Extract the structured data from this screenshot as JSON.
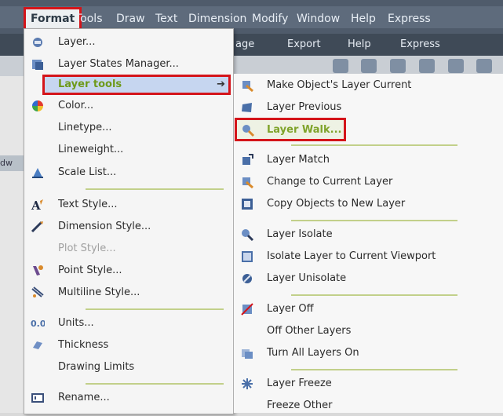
{
  "menubar": {
    "items": [
      "Format",
      "Tools",
      "Draw",
      "Text",
      "Dimension",
      "Modify",
      "Window",
      "Help",
      "Express"
    ]
  },
  "ribbon": {
    "items": [
      "age",
      "Export",
      "Help",
      "Express"
    ]
  },
  "left_tab_label": "dw",
  "format_menu": {
    "items": [
      {
        "label": "Layer...",
        "icon": "layer-icon"
      },
      {
        "label": "Layer States Manager...",
        "icon": "layer-states-icon"
      },
      {
        "label": "Layer tools",
        "icon": "",
        "submenu": true
      },
      {
        "label": "Color...",
        "icon": "color-wheel-icon"
      },
      {
        "label": "Linetype...",
        "icon": ""
      },
      {
        "label": "Lineweight...",
        "icon": ""
      },
      {
        "label": "Scale List...",
        "icon": "scale-list-icon"
      },
      {
        "label": "Text Style...",
        "icon": "text-style-icon"
      },
      {
        "label": "Dimension Style...",
        "icon": "dimension-style-icon"
      },
      {
        "label": "Plot Style...",
        "icon": "",
        "disabled": true
      },
      {
        "label": "Point Style...",
        "icon": "point-style-icon"
      },
      {
        "label": "Multiline Style...",
        "icon": "multiline-style-icon"
      },
      {
        "label": "Units...",
        "icon": "units-icon"
      },
      {
        "label": "Thickness",
        "icon": "thickness-icon"
      },
      {
        "label": "Drawing Limits",
        "icon": ""
      },
      {
        "label": "Rename...",
        "icon": "rename-icon"
      }
    ],
    "submenu_arrow": "➔"
  },
  "layer_tools_menu": {
    "items": [
      {
        "label": "Make Object's Layer Current",
        "icon": "make-current-icon"
      },
      {
        "label": "Layer Previous",
        "icon": "layer-previous-icon"
      },
      {
        "label": "Layer Walk...",
        "icon": "layer-walk-icon",
        "highlighted": true
      },
      {
        "label": "Layer Match",
        "icon": "layer-match-icon"
      },
      {
        "label": "Change to Current Layer",
        "icon": "change-current-icon"
      },
      {
        "label": "Copy Objects to New Layer",
        "icon": "copy-objects-icon"
      },
      {
        "label": "Layer Isolate",
        "icon": "layer-isolate-icon"
      },
      {
        "label": "Isolate Layer to Current Viewport",
        "icon": "isolate-viewport-icon"
      },
      {
        "label": "Layer Unisolate",
        "icon": "layer-unisolate-icon"
      },
      {
        "label": "Layer Off",
        "icon": "layer-off-icon"
      },
      {
        "label": "Off Other Layers",
        "icon": ""
      },
      {
        "label": "Turn All Layers On",
        "icon": "turn-all-on-icon"
      },
      {
        "label": "Layer Freeze",
        "icon": "layer-freeze-icon"
      },
      {
        "label": "Freeze Other",
        "icon": ""
      }
    ]
  },
  "colors": {
    "highlight_border": "#d4141a",
    "highlight_text": "#6e9a1b",
    "separator": "#c2d08a",
    "menubar": "#5e6b7c"
  }
}
